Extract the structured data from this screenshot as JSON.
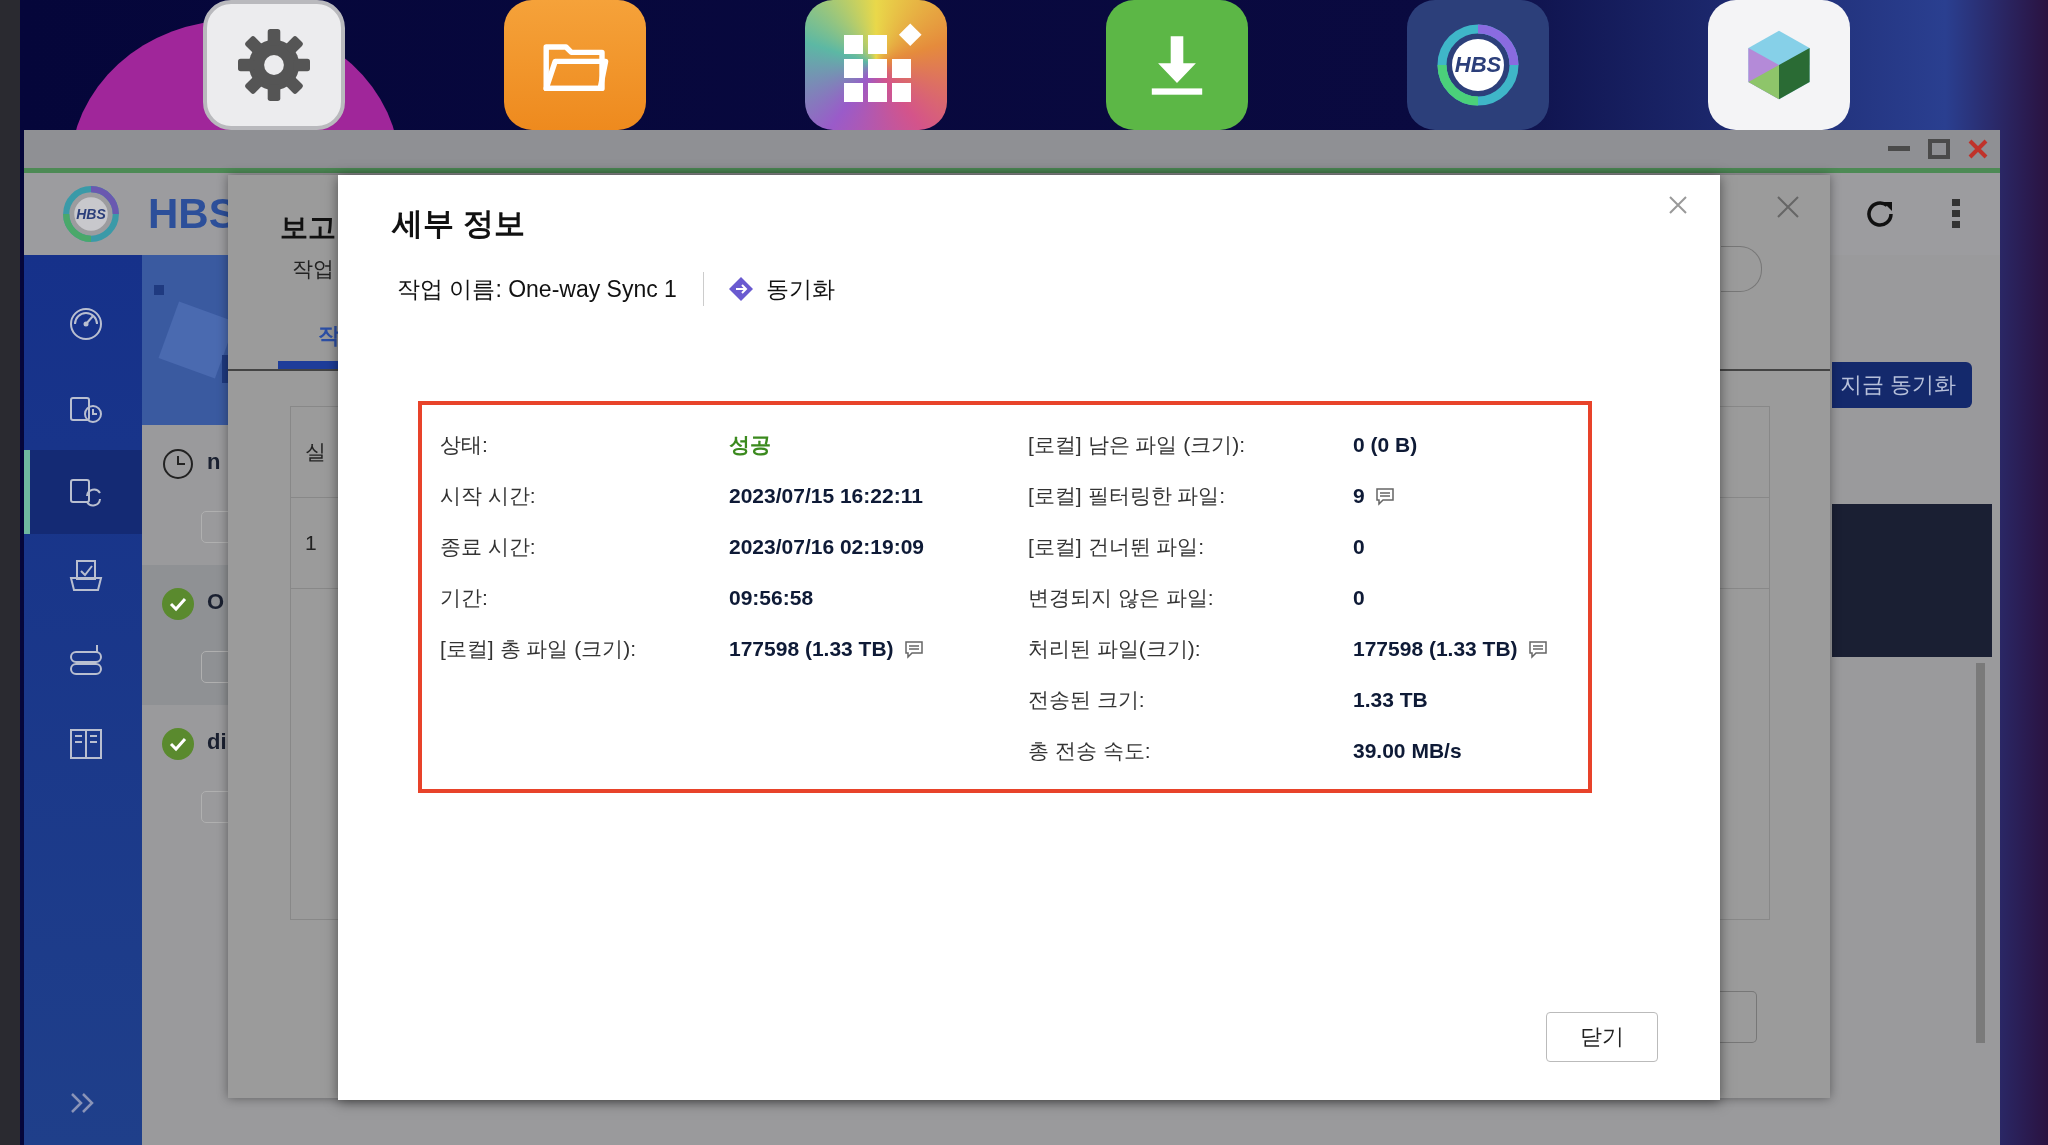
{
  "dock": [
    {
      "kind": "settings"
    },
    {
      "kind": "folder"
    },
    {
      "kind": "apps"
    },
    {
      "kind": "download"
    },
    {
      "kind": "hbs",
      "logo_text": "HBS"
    },
    {
      "kind": "cube"
    }
  ],
  "app": {
    "logo_text": "HBS",
    "title": "HBS"
  },
  "sidebar": [
    {
      "kind": "dashboard",
      "selected": false
    },
    {
      "kind": "backup",
      "selected": false
    },
    {
      "kind": "sync",
      "selected": true
    },
    {
      "kind": "restore",
      "selected": false
    },
    {
      "kind": "storage",
      "selected": false
    },
    {
      "kind": "services",
      "selected": false
    }
  ],
  "task_list": [
    {
      "kind": "scheduled",
      "name": "n"
    },
    {
      "kind": "success",
      "name": "O"
    },
    {
      "kind": "success",
      "name": "di"
    }
  ],
  "sync_now_button": "지금 동기화",
  "report_dialog": {
    "title": "보고",
    "label": "작업",
    "tab": "작",
    "table": {
      "header": "실",
      "rows": [
        "1"
      ]
    }
  },
  "detail_dialog": {
    "title": "세부 정보",
    "job_name": "작업 이름: One-way Sync 1",
    "job_type": "동기화",
    "left_fields": [
      {
        "label": "상태:",
        "value": "성공",
        "kind": "status",
        "has_note": false
      },
      {
        "label": "시작 시간:",
        "value": "2023/07/15 16:22:11",
        "kind": "value",
        "has_note": false
      },
      {
        "label": "종료 시간:",
        "value": "2023/07/16 02:19:09",
        "kind": "value",
        "has_note": false
      },
      {
        "label": "기간:",
        "value": "09:56:58",
        "kind": "value",
        "has_note": false
      },
      {
        "label": "[로컬] 총 파일 (크기):",
        "value": "177598 (1.33 TB)",
        "kind": "value",
        "has_note": true
      }
    ],
    "right_fields": [
      {
        "label": "[로컬] 남은 파일 (크기):",
        "value": "0 (0 B)",
        "kind": "value",
        "has_note": false
      },
      {
        "label": "[로컬] 필터링한 파일:",
        "value": "9",
        "kind": "value",
        "has_note": true
      },
      {
        "label": "[로컬] 건너뛴 파일:",
        "value": "0",
        "kind": "value",
        "has_note": false
      },
      {
        "label": "변경되지 않은 파일:",
        "value": "0",
        "kind": "value",
        "has_note": false
      },
      {
        "label": "처리된 파일(크기):",
        "value": "177598 (1.33 TB)",
        "kind": "value",
        "has_note": true
      },
      {
        "label": "전송된 크기:",
        "value": "1.33 TB",
        "kind": "value",
        "has_note": false
      },
      {
        "label": "총 전송 속도:",
        "value": "39.00 MB/s",
        "kind": "value",
        "has_note": false
      }
    ],
    "close_button": "닫기"
  }
}
